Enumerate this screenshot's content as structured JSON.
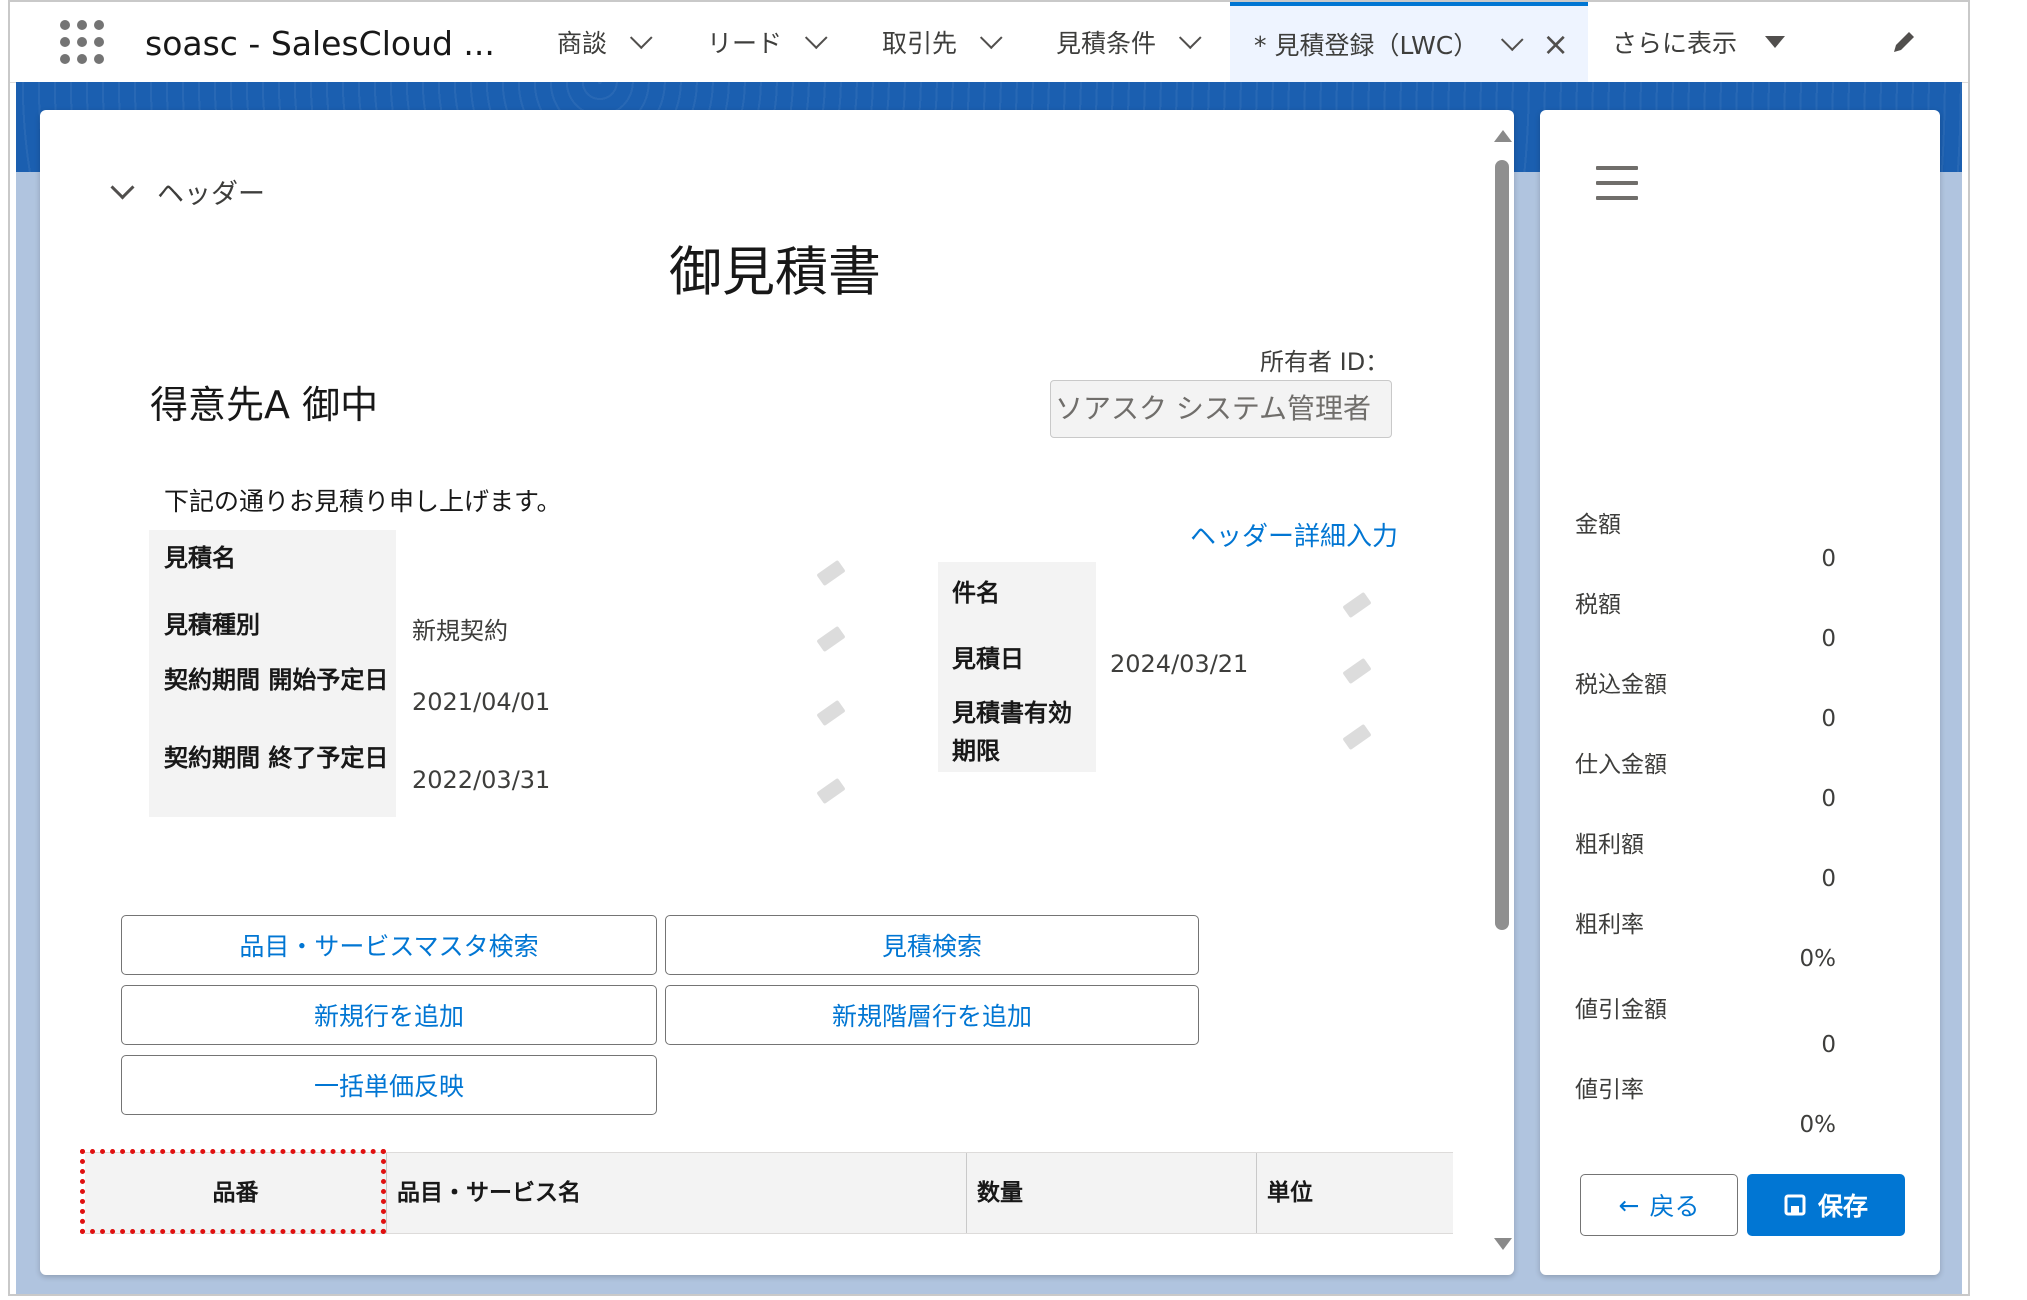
{
  "nav": {
    "app_name": "soasc - SalesCloud ...",
    "tabs": [
      {
        "label": "商談"
      },
      {
        "label": "リード"
      },
      {
        "label": "取引先"
      },
      {
        "label": "見積条件"
      },
      {
        "label": "* 見積登録（LWC）"
      },
      {
        "label": "さらに表示"
      }
    ]
  },
  "form": {
    "header_toggle": "ヘッダー",
    "doc_title": "御見積書",
    "customer": "得意先A 御中",
    "owner_label": "所有者 ID：",
    "owner_value": "ソアスク システム管理者",
    "intro": "下記の通りお見積り申し上げます。",
    "detail_link": "ヘッダー詳細入力",
    "left_fields": [
      {
        "label": "見積名",
        "value": ""
      },
      {
        "label": "見積種別",
        "value": "新規契約"
      },
      {
        "label": "契約期間 開始予定日",
        "value": "2021/04/01"
      },
      {
        "label": "契約期間 終了予定日",
        "value": "2022/03/31"
      }
    ],
    "right_fields": [
      {
        "label": "件名",
        "value": ""
      },
      {
        "label": "見積日",
        "value": "2024/03/21"
      },
      {
        "label": "見積書有効期限",
        "value": ""
      }
    ]
  },
  "buttons": {
    "item_search": "品目・サービスマスタ検索",
    "quote_search": "見積検索",
    "add_row": "新規行を追加",
    "add_level_row": "新規階層行を追加",
    "bulk_price": "一括単価反映"
  },
  "table": {
    "columns": [
      "品番",
      "品目・サービス名",
      "数量",
      "単位"
    ]
  },
  "summary": {
    "items": [
      {
        "label": "金額",
        "value": "0"
      },
      {
        "label": "税額",
        "value": "0"
      },
      {
        "label": "税込金額",
        "value": "0"
      },
      {
        "label": "仕入金額",
        "value": "0"
      },
      {
        "label": "粗利額",
        "value": "0"
      },
      {
        "label": "粗利率",
        "value": "0%"
      },
      {
        "label": "値引金額",
        "value": "0"
      },
      {
        "label": "値引率",
        "value": "0%"
      }
    ],
    "back_label": "戻る",
    "save_label": "保存"
  },
  "colors": {
    "brand_blue": "#0176d3",
    "highlight_red": "#e01010"
  }
}
